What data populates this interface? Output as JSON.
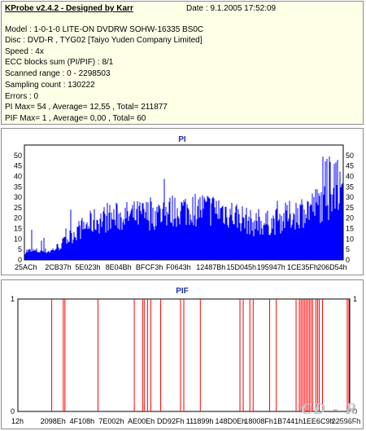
{
  "info": {
    "title": "KProbe v2.4.2 - Designed by Karr",
    "date": "Date : 9.1.2005 17:52:09",
    "lines": [
      "Model : 1-0-1-0 LITE-ON DVDRW SOHW-16335 BS0C",
      "Disc : DVD-R , TYG02 [Taiyo Yuden Company Limited]",
      "Speed : 4x",
      "ECC blocks sum (PI/PIF) : 8/1",
      "Scanned range : 0 - 2298503",
      "Sampling count : 130222",
      "Errors : 0",
      "PI Max= 54 , Average= 12,55 , Total= 211877",
      "PIF Max= 1 , Average= 0,00 , Total= 60"
    ]
  },
  "watermark": {
    "main": "CD - R",
    "sub": "www.cdr.cz"
  },
  "chart_data": [
    {
      "type": "area",
      "title": "PI",
      "color": "#0000ff",
      "ylim": [
        0,
        55
      ],
      "yticks": [
        0,
        5,
        10,
        15,
        20,
        25,
        30,
        35,
        40,
        45,
        50
      ],
      "xticks": [
        "25ACh",
        "2CB37h",
        "5E023h",
        "8E04Bh",
        "BFCF3h",
        "F0643h",
        "12487Bh",
        "15D045h",
        "195947h",
        "1CE35Fh",
        "206D54h"
      ],
      "max": 54,
      "profile": [
        [
          0,
          5
        ],
        [
          0.08,
          5
        ],
        [
          0.11,
          8
        ],
        [
          0.16,
          16
        ],
        [
          0.22,
          22
        ],
        [
          0.28,
          24
        ],
        [
          0.35,
          25
        ],
        [
          0.42,
          26
        ],
        [
          0.48,
          28
        ],
        [
          0.55,
          29
        ],
        [
          0.62,
          28
        ],
        [
          0.68,
          24
        ],
        [
          0.72,
          20
        ],
        [
          0.78,
          21
        ],
        [
          0.85,
          26
        ],
        [
          0.92,
          31
        ],
        [
          1.0,
          38
        ]
      ]
    },
    {
      "type": "bar",
      "title": "PIF",
      "color": "#ff0000",
      "ylim": [
        0,
        1
      ],
      "yticks": [
        0,
        1
      ],
      "xticks": [
        "12h",
        "2098Eh",
        "4F108h",
        "7E002h",
        "AE00Eh",
        "DD92Fh",
        "111899h",
        "148D0Eh",
        "18008Fh",
        "1B7441h",
        "1EE6C9h",
        "22596Fh"
      ],
      "events": [
        0.1,
        0.135,
        0.14,
        0.24,
        0.35,
        0.375,
        0.38,
        0.39,
        0.4,
        0.43,
        0.49,
        0.5,
        0.55,
        0.67,
        0.68,
        0.7,
        0.71,
        0.76,
        0.78,
        0.84,
        0.85,
        0.855,
        0.86,
        0.865,
        0.87,
        0.875,
        0.88,
        0.885,
        0.89,
        0.9,
        0.905,
        0.91,
        0.92,
        0.995,
        1.0
      ],
      "values_each": 1
    }
  ]
}
